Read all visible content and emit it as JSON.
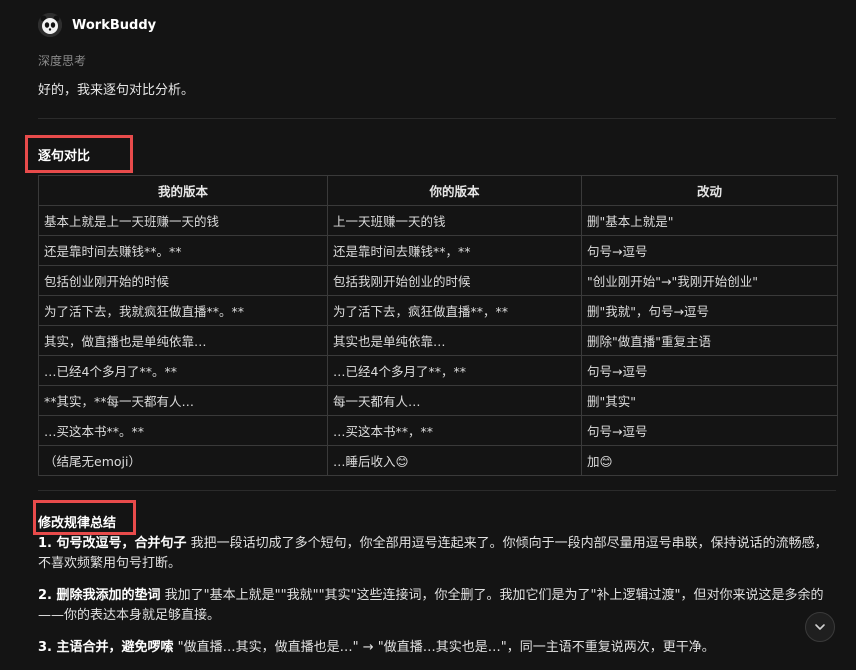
{
  "app": {
    "name": "WorkBuddy",
    "avatar_icon": "panda-icon"
  },
  "thinking_label": "深度思考",
  "intro": "好的，我来逐句对比分析。",
  "section1": {
    "title": "逐句对比"
  },
  "table": {
    "headers": [
      "我的版本",
      "你的版本",
      "改动"
    ],
    "rows": [
      [
        "基本上就是上一天班赚一天的钱",
        "上一天班赚一天的钱",
        "删\"基本上就是\""
      ],
      [
        "还是靠时间去赚钱**。**",
        "还是靠时间去赚钱**，**",
        "句号→逗号"
      ],
      [
        "包括创业刚开始的时候",
        "包括我刚开始创业的时候",
        "\"创业刚开始\"→\"我刚开始创业\""
      ],
      [
        "为了活下去，我就疯狂做直播**。**",
        "为了活下去，疯狂做直播**，**",
        "删\"我就\"，句号→逗号"
      ],
      [
        "其实，做直播也是单纯依靠…",
        "其实也是单纯依靠…",
        "删除\"做直播\"重复主语"
      ],
      [
        "…已经4个多月了**。**",
        "…已经4个多月了**，**",
        "句号→逗号"
      ],
      [
        "**其实，**每一天都有人…",
        "每一天都有人…",
        "删\"其实\""
      ],
      [
        "…买这本书**。**",
        "…买这本书**，**",
        "句号→逗号"
      ],
      [
        "（结尾无emoji）",
        "…睡后收入😊",
        "加😊"
      ]
    ]
  },
  "section2": {
    "title": "修改规律总结"
  },
  "rules": [
    {
      "title": "1. 句号改逗号，合并句子",
      "text": " 我把一段话切成了多个短句，你全部用逗号连起来了。你倾向于一段内部尽量用逗号串联，保持说话的流畅感，不喜欢频繁用句号打断。"
    },
    {
      "title": "2. 删除我添加的垫词",
      "text": " 我加了\"基本上就是\"\"我就\"\"其实\"这些连接词，你全删了。我加它们是为了\"补上逻辑过渡\"，但对你来说这是多余的——你的表达本身就足够直接。"
    },
    {
      "title": "3. 主语合并，避免啰嗦",
      "text": " \"做直播…其实，做直播也是…\" → \"做直播…其实也是…\"，同一主语不重复说两次，更干净。"
    }
  ],
  "colors": {
    "background": "#141414",
    "highlight_box": "#e84b4b",
    "border": "#3a3a3a"
  },
  "scroll_icon": "chevron-down-icon"
}
